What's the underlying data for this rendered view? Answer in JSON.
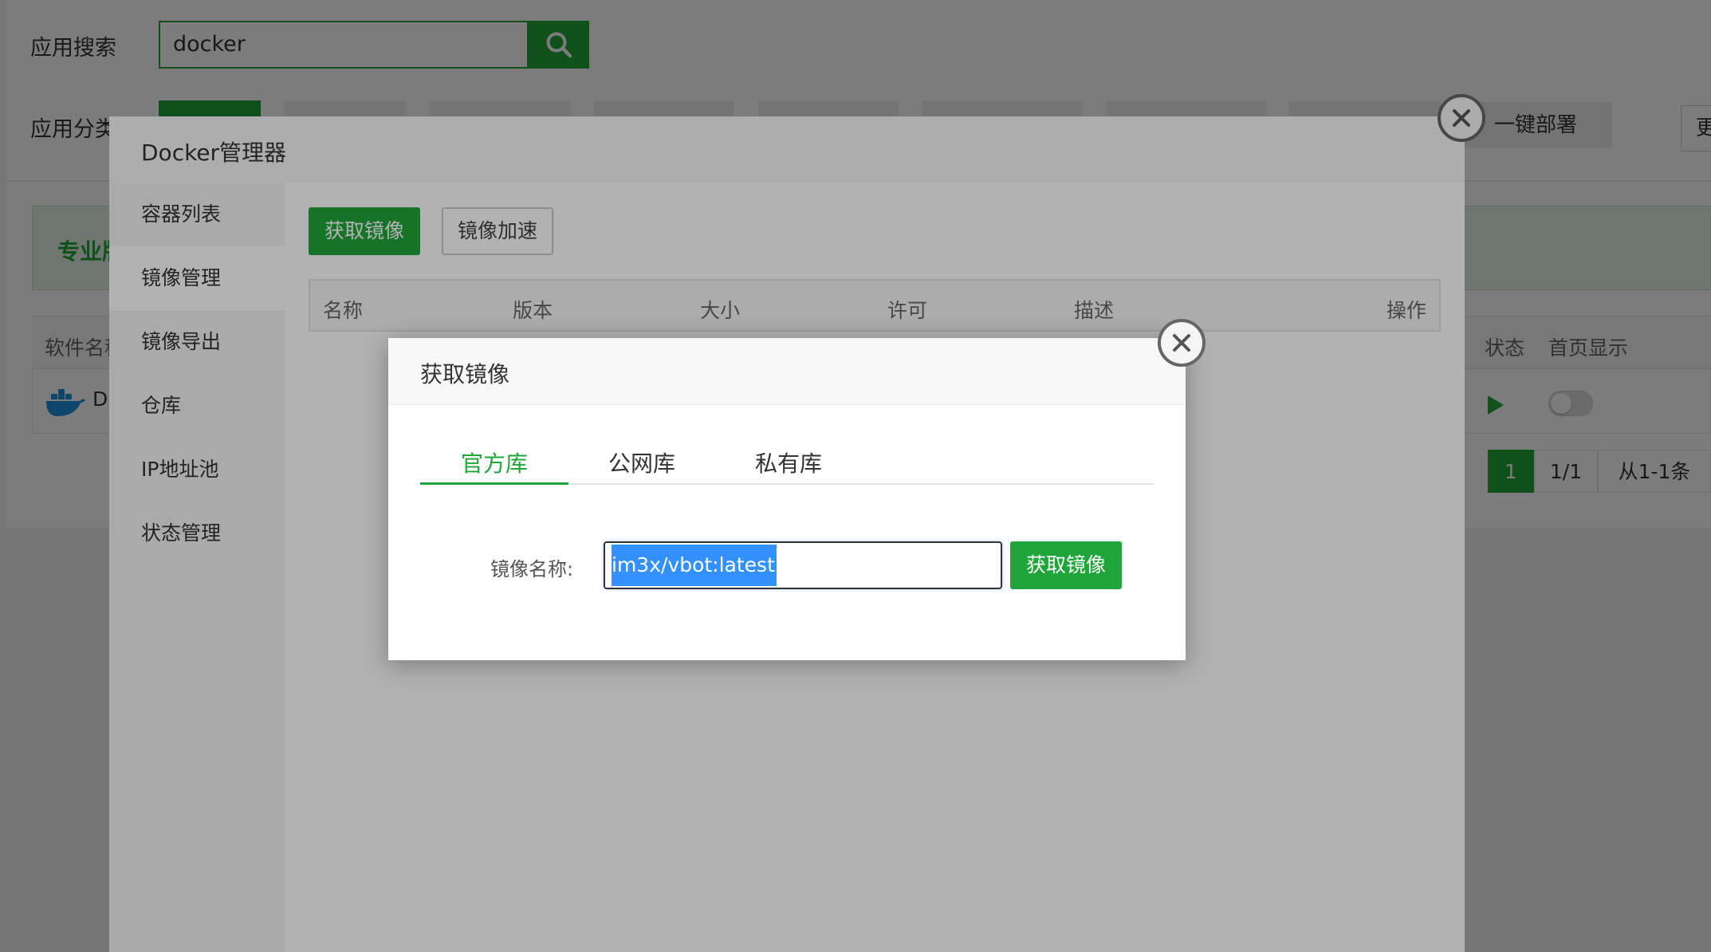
{
  "background": {
    "search_label": "应用搜索",
    "search_value": "docker",
    "category_label": "应用分类",
    "deploy_button": "一键部署",
    "more_button": "更",
    "pro_banner": "专业版",
    "table_headers": {
      "name": "软件名称",
      "status": "状态",
      "home_display": "首页显示"
    },
    "row_name": "D",
    "pager": {
      "current": "1",
      "pages": "1/1",
      "range": "从1-1条"
    }
  },
  "docker_manager": {
    "title": "Docker管理器",
    "sidebar": [
      {
        "label": "容器列表"
      },
      {
        "label": "镜像管理"
      },
      {
        "label": "镜像导出"
      },
      {
        "label": "仓库"
      },
      {
        "label": "IP地址池"
      },
      {
        "label": "状态管理"
      }
    ],
    "active_sidebar": "镜像管理",
    "buttons": {
      "get_image": "获取镜像",
      "accelerate": "镜像加速"
    },
    "table_headers": [
      "名称",
      "版本",
      "大小",
      "许可",
      "描述",
      "操作"
    ]
  },
  "fetch_dialog": {
    "title": "获取镜像",
    "tabs": [
      {
        "label": "官方库"
      },
      {
        "label": "公网库"
      },
      {
        "label": "私有库"
      }
    ],
    "active_tab": "官方库",
    "field_label": "镜像名称:",
    "input_value": "im3x/vbot:latest",
    "submit_button": "获取镜像"
  },
  "colors": {
    "accent": "#20a53a",
    "selection": "#3390ff"
  },
  "icons": {
    "search": "search-icon",
    "close": "close-icon",
    "docker": "docker-icon",
    "play": "play-icon"
  }
}
